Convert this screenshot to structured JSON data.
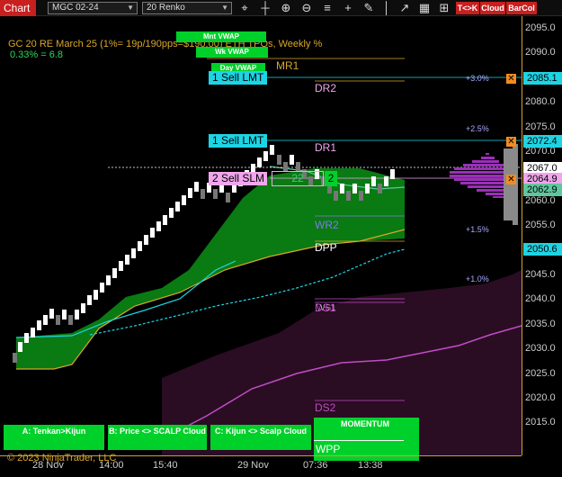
{
  "toolbar": {
    "chart_label": "Chart",
    "instrument": "MGC 02-24",
    "bar_type": "20 Renko",
    "icon_names": [
      "crosshair-icon",
      "bar-style-icon",
      "zoom-in-icon",
      "zoom-out-icon",
      "properties-icon",
      "plus-icon",
      "drawing-tools-icon",
      "vertical-line-icon",
      "hide-icon",
      "trend-icon",
      "data-box-icon",
      "chart-trader-icon"
    ],
    "buttons": [
      "T<>K",
      "Cloud",
      "BarCol"
    ]
  },
  "header": {
    "title": "GC 20 RE March 25 (1%= 19p/190pps=$190.00) ETH TPOs, Weekly %",
    "subtitle": "0.33% = 6.8"
  },
  "vwap": {
    "monthly": "Mnt VWAP",
    "weekly": "Wk VWAP",
    "daily": "Day VWAP"
  },
  "levels": {
    "mr1": "MR1",
    "dr2": "DR2",
    "dr1": "DR1",
    "wr2": "WR2",
    "dpp": "DPP",
    "ds1": "DS1",
    "ws1": "WS1",
    "ds2": "DS2",
    "wpp": "WPP"
  },
  "orders": {
    "sell1_top": "1 Sell LMT",
    "sell1_mid": "1 Sell LMT",
    "sell2": "2 Sell SLM",
    "qty": "22",
    "qty2": "2"
  },
  "pct_markers": [
    "+3.0%",
    "+2.5%",
    "+1.5%",
    "+1.0%"
  ],
  "y_axis": {
    "ticks": [
      "2095.0",
      "2090.0",
      "2085.0",
      "2080.0",
      "2075.0",
      "2070.0",
      "2065.0",
      "2060.0",
      "2055.0",
      "2050.0",
      "2045.0",
      "2040.0",
      "2035.0",
      "2030.0",
      "2025.0",
      "2020.0",
      "2015.0"
    ],
    "boxes": {
      "p2085": "2085.1",
      "p2072": "2072.4",
      "p2067": "2067.0",
      "p2064": "2064.9",
      "p2062": "2062.9",
      "p2050": "2050.6"
    }
  },
  "x_axis": {
    "ticks": [
      "28 Nov",
      "14:00",
      "15:40",
      "29 Nov",
      "07:36",
      "13:38"
    ]
  },
  "bottom_buttons": {
    "tenkan": "A: Tenkan>Kijun",
    "price_scalp": "B: Price <> SCALP Cloud",
    "kijun_scalp": "C: Kijun <> Scalp Cloud",
    "momentum": "MOMENTUM"
  },
  "footer": {
    "copyright": "© 2023 NinjaTrader, LLC"
  },
  "colors": {
    "accent": "#c81f1f",
    "green": "#00d12a",
    "cyan": "#1ed4e4",
    "pink": "#f0a6ec",
    "gold": "#d9a72b",
    "cloud": "#0a7a12",
    "magenta": "#c04cc8"
  }
}
